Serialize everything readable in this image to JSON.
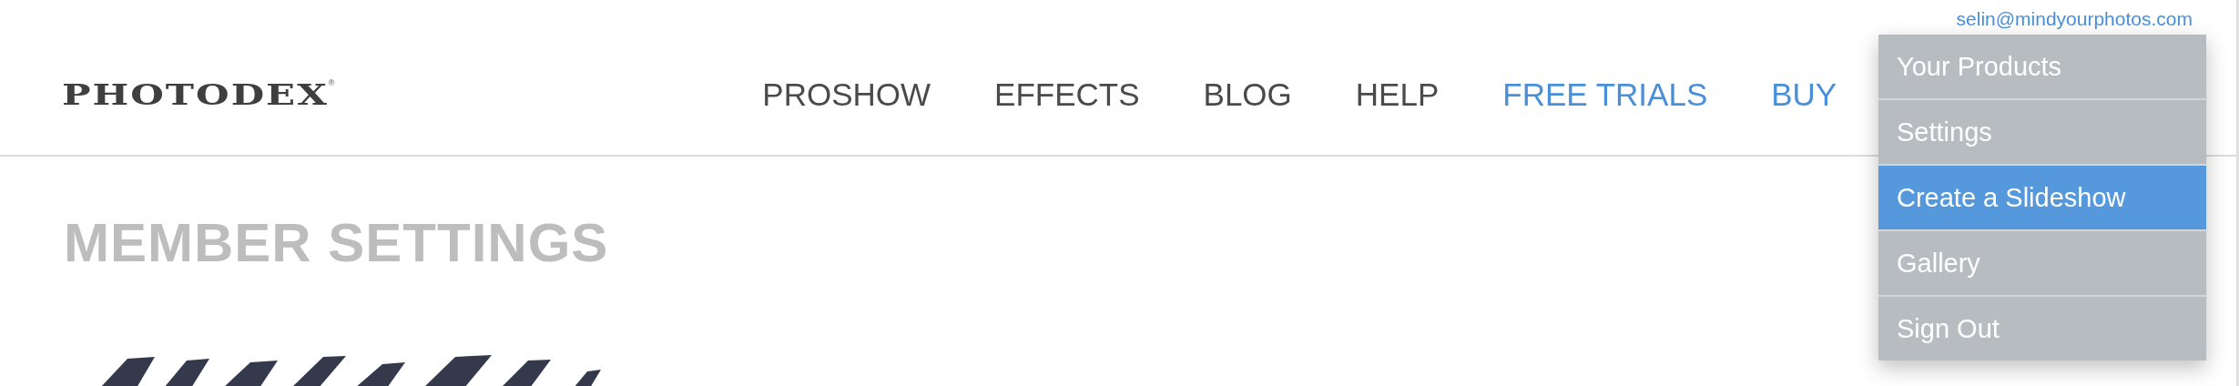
{
  "account": {
    "email": "selin@mindyourphotos.com"
  },
  "logo": {
    "text": "PHOTODEX",
    "mark": "®"
  },
  "nav": [
    {
      "label": "PROSHOW",
      "color": "#4a4a4a"
    },
    {
      "label": "EFFECTS",
      "color": "#4a4a4a"
    },
    {
      "label": "BLOG",
      "color": "#4a4a4a"
    },
    {
      "label": "HELP",
      "color": "#4a4a4a"
    },
    {
      "label": "FREE TRIALS",
      "color": "#4a90d9"
    },
    {
      "label": "BUY",
      "color": "#4a90d9"
    }
  ],
  "account_menu": [
    {
      "label": "Your Products",
      "selected": false
    },
    {
      "label": "Settings",
      "selected": false
    },
    {
      "label": "Create a Slideshow",
      "selected": true
    },
    {
      "label": "Gallery",
      "selected": false
    },
    {
      "label": "Sign Out",
      "selected": false
    }
  ],
  "page": {
    "title": "MEMBER SETTINGS"
  }
}
